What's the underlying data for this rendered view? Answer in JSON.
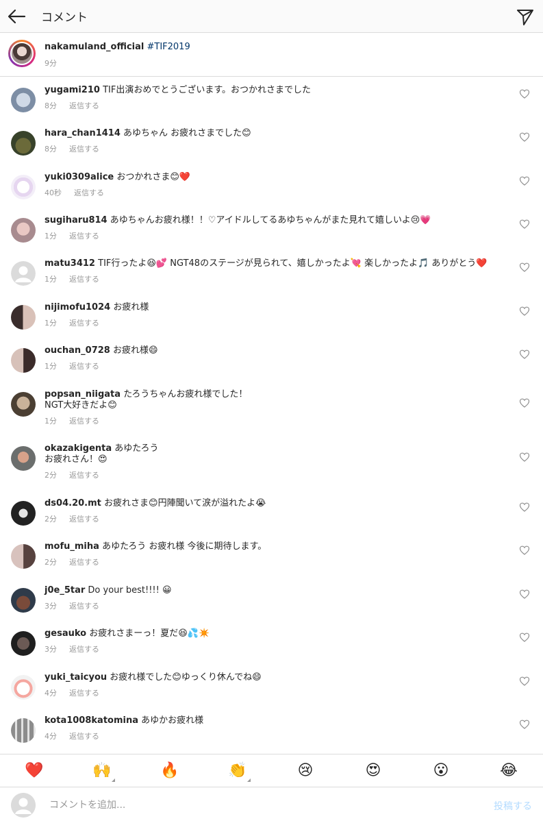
{
  "header": {
    "title": "コメント"
  },
  "caption": {
    "username": "nakamuland_official",
    "hashtag": "#TIF2019",
    "time": "9分"
  },
  "reply_label": "返信する",
  "comments": [
    {
      "user": "yugami210",
      "text": "TIF出演おめでとうございます。おつかれさまでした",
      "time": "8分"
    },
    {
      "user": "hara_chan1414",
      "text": "あゆちゃん お疲れさまでした😊",
      "time": "8分"
    },
    {
      "user": "yuki0309alice",
      "text": "おつかれさま😊❤️",
      "time": "40秒"
    },
    {
      "user": "sugiharu814",
      "text": "あゆちゃんお疲れ様！！♡アイドルしてるあゆちゃんがまた見れて嬉しいよ😢💗",
      "time": "1分"
    },
    {
      "user": "matu3412",
      "text": "TIF行ったよ😆💕 NGT48のステージが見られて、嬉しかったよ💘 楽しかったよ🎵 ありがとう❤️",
      "time": "1分"
    },
    {
      "user": "nijimofu1024",
      "text": "お疲れ様",
      "time": "1分"
    },
    {
      "user": "ouchan_0728",
      "text": "お疲れ様😄",
      "time": "1分"
    },
    {
      "user": "popsan_niigata",
      "text": "たろうちゃんお疲れ様でした！\nNGT大好きだよ😊",
      "time": "1分"
    },
    {
      "user": "okazakigenta",
      "text": "あゆたろう\nお疲れさん！😍",
      "time": "2分"
    },
    {
      "user": "ds04.20.mt",
      "text": "お疲れさま😊円陣聞いて涙が溢れたよ😭",
      "time": "2分"
    },
    {
      "user": "mofu_miha",
      "text": "あゆたろう お疲れ様 今後に期待します。",
      "time": "2分"
    },
    {
      "user": "j0e_5tar",
      "text": "Do your best!!!! 😀",
      "time": "3分"
    },
    {
      "user": "gesauko",
      "text": "お疲れさまーっ！夏だ😆💦✴️",
      "time": "3分"
    },
    {
      "user": "yuki_taicyou",
      "text": "お疲れ様でした😊ゆっくり休んでね😄",
      "time": "4分"
    },
    {
      "user": "kota1008katomina",
      "text": "あゆかお疲れ様",
      "time": "4分"
    }
  ],
  "emoji_bar": [
    "❤️",
    "🙌",
    "🔥",
    "👏",
    "😢",
    "😍",
    "😮",
    "😂"
  ],
  "input": {
    "placeholder": "コメントを追加...",
    "post_label": "投稿する"
  },
  "colors": {
    "link": "#003569",
    "muted": "#999999",
    "post_disabled": "#b3dbff",
    "divider": "#dbdbdb"
  }
}
